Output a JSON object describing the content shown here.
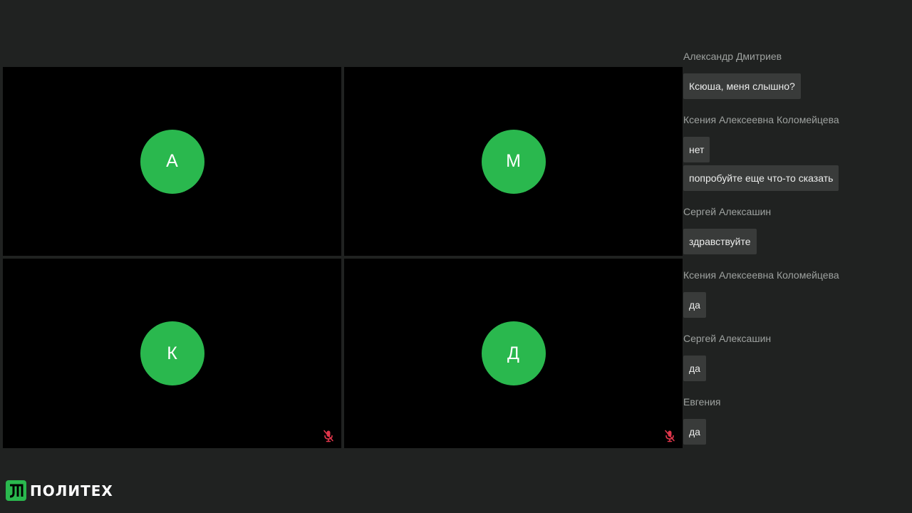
{
  "participants": [
    {
      "initial": "А",
      "muted": false
    },
    {
      "initial": "М",
      "muted": false
    },
    {
      "initial": "К",
      "muted": true
    },
    {
      "initial": "Д",
      "muted": true
    }
  ],
  "chat": [
    {
      "sender": "Александр Дмитриев",
      "messages": [
        "Ксюша, меня слышно?"
      ]
    },
    {
      "sender": "Ксения Алексеевна Коломейцева",
      "messages": [
        "нет",
        "попробуйте еще что-то сказать"
      ]
    },
    {
      "sender": "Сергей Алексашин",
      "messages": [
        "здравствуйте"
      ]
    },
    {
      "sender": "Ксения Алексеевна Коломейцева",
      "messages": [
        "да"
      ]
    },
    {
      "sender": "Сергей Алексашин",
      "messages": [
        "да"
      ]
    },
    {
      "sender": "Евгения",
      "messages": [
        "да"
      ]
    }
  ],
  "brand": {
    "name": "ПОЛИТЕХ",
    "accent_color": "#2ab84e",
    "mic_off_color": "#e0364b"
  },
  "icons": {
    "muted": "microphone-off-icon",
    "logo": "politech-logo-icon"
  }
}
